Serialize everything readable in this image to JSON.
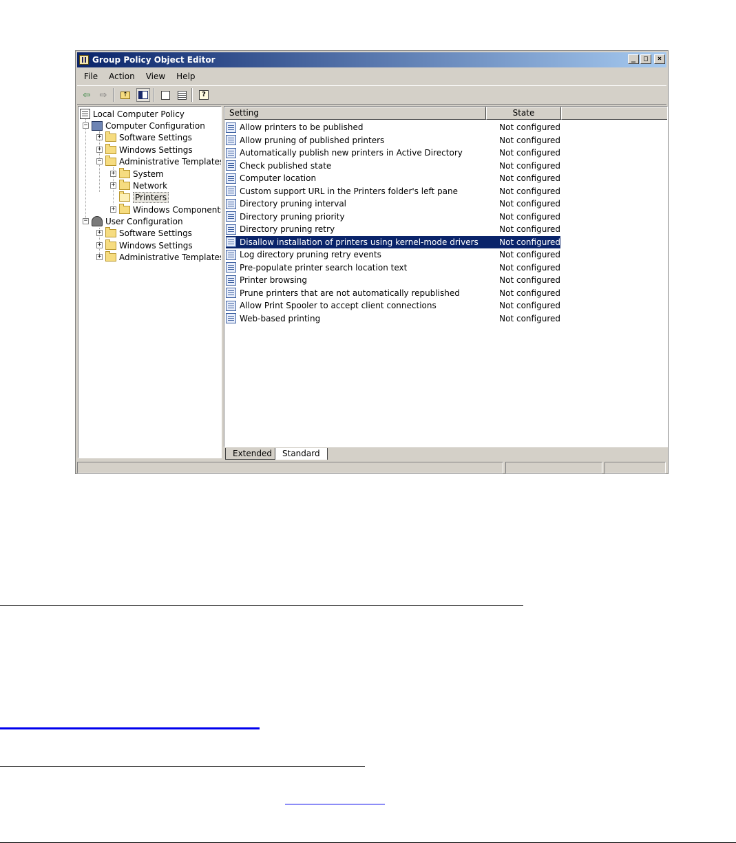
{
  "window": {
    "title": "Group Policy Object Editor",
    "controls": [
      "_",
      "□",
      "×"
    ]
  },
  "menu": [
    {
      "label": "File"
    },
    {
      "label": "Action"
    },
    {
      "label": "View"
    },
    {
      "label": "Help"
    }
  ],
  "toolbar": {
    "icons": [
      "back-icon",
      "forward-icon",
      "up-one-level-icon",
      "show-hide-tree-icon",
      "properties-icon",
      "export-list-icon",
      "help-icon"
    ]
  },
  "tree": {
    "root": "Local Computer Policy",
    "computer_configuration": "Computer Configuration",
    "cc_software_settings": "Software Settings",
    "cc_windows_settings": "Windows Settings",
    "cc_admin_templates": "Administrative Templates",
    "system": "System",
    "network": "Network",
    "printers": "Printers",
    "windows_components": "Windows Components",
    "user_configuration": "User Configuration",
    "uc_software_settings": "Software Settings",
    "uc_windows_settings": "Windows Settings",
    "uc_admin_templates": "Administrative Templates"
  },
  "list": {
    "columns": [
      "Setting",
      "State"
    ],
    "rows": [
      {
        "setting": "Allow printers to be published",
        "state": "Not configured"
      },
      {
        "setting": "Allow pruning of published printers",
        "state": "Not configured"
      },
      {
        "setting": "Automatically publish new printers in Active Directory",
        "state": "Not configured"
      },
      {
        "setting": "Check published state",
        "state": "Not configured"
      },
      {
        "setting": "Computer location",
        "state": "Not configured"
      },
      {
        "setting": "Custom support URL in the Printers folder's left pane",
        "state": "Not configured"
      },
      {
        "setting": "Directory pruning interval",
        "state": "Not configured"
      },
      {
        "setting": "Directory pruning priority",
        "state": "Not configured"
      },
      {
        "setting": "Directory pruning retry",
        "state": "Not configured"
      },
      {
        "setting": "Disallow installation of printers using kernel-mode drivers",
        "state": "Not configured"
      },
      {
        "setting": "Log directory pruning retry events",
        "state": "Not configured"
      },
      {
        "setting": "Pre-populate printer search location text",
        "state": "Not configured"
      },
      {
        "setting": "Printer browsing",
        "state": "Not configured"
      },
      {
        "setting": "Prune printers that are not automatically republished",
        "state": "Not configured"
      },
      {
        "setting": "Allow Print Spooler to accept client connections",
        "state": "Not configured"
      },
      {
        "setting": "Web-based printing",
        "state": "Not configured"
      }
    ]
  },
  "tabs": [
    {
      "label": "Extended"
    },
    {
      "label": "Standard"
    }
  ]
}
